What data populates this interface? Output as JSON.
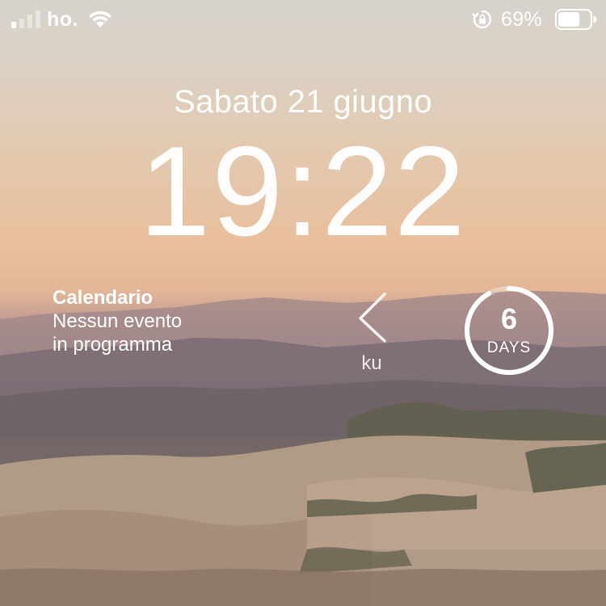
{
  "status_bar": {
    "carrier": "ho.",
    "battery_percent": "69%",
    "battery_level": 0.69,
    "signal_bars_active": 1,
    "signal_bars_total": 4,
    "icons": [
      "signal-icon",
      "wifi-icon",
      "lock-rotation-icon",
      "battery-icon"
    ]
  },
  "lock_screen": {
    "date": "Sabato 21 giugno",
    "time": "19:22"
  },
  "widgets": {
    "calendar": {
      "title": "Calendario",
      "line1": "Nessun evento",
      "line2": "in programma"
    },
    "countdown_back": {
      "icon": "chevron-left-icon",
      "label": "ku"
    },
    "days": {
      "number": "6",
      "unit": "DAYS",
      "ring_progress": 0.92
    }
  },
  "colors": {
    "text": "#ffffff",
    "ring_track": "rgba(255,255,255,0.35)",
    "ring_fill": "#ffffff"
  }
}
